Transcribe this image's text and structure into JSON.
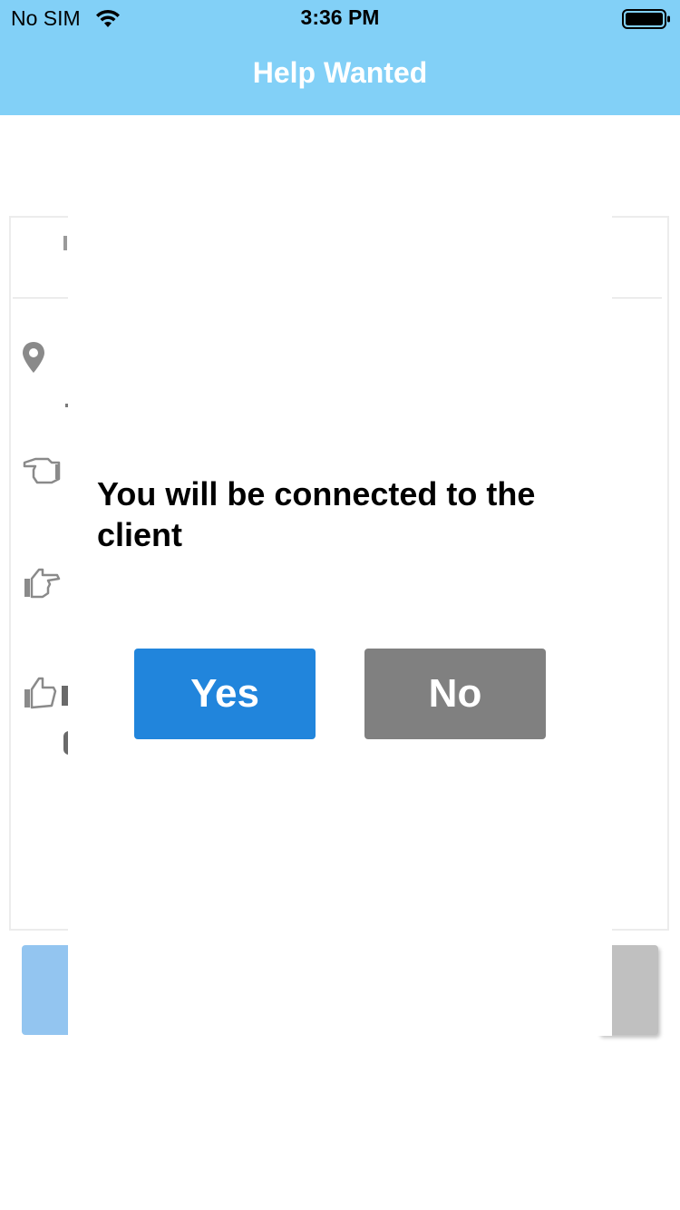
{
  "status_bar": {
    "carrier": "No SIM",
    "time": "3:36 PM",
    "wifi_icon": "wifi-icon",
    "battery_icon": "battery-full-icon"
  },
  "header": {
    "title": "Help Wanted",
    "background_color": "#82d0f7"
  },
  "background_card": {
    "icons": [
      "location-pin-icon",
      "hand-pointing-left-icon",
      "hand-pointing-right-icon",
      "thumbs-up-icon"
    ]
  },
  "dialog": {
    "message": "You will be connected to the client",
    "yes_label": "Yes",
    "no_label": "No",
    "yes_color": "#2185dc",
    "no_color": "#808080"
  }
}
